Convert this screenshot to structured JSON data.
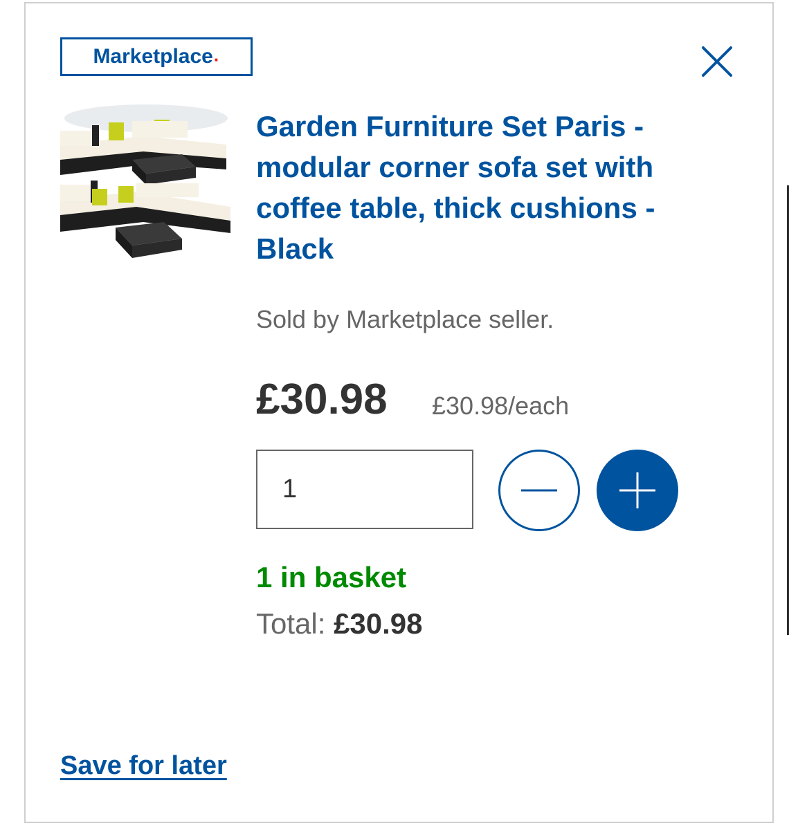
{
  "badge": {
    "label": "Marketplace",
    "dot": "·"
  },
  "close": {
    "icon": "close-icon"
  },
  "product": {
    "image_alt": "Garden furniture set image",
    "title": "Garden Furniture Set Paris - modular corner sofa set with coffee table, thick cushions - Black",
    "seller_text": "Sold by Marketplace seller.",
    "price": "£30.98",
    "unit_price": "£30.98/each"
  },
  "quantity": {
    "value": "1"
  },
  "controls": {
    "minus_icon": "minus-icon",
    "plus_icon": "plus-icon"
  },
  "basket": {
    "status": "1 in basket",
    "total_label": "Total:",
    "total_value": "£30.98"
  },
  "actions": {
    "save_for_later": "Save for later"
  },
  "colors": {
    "brand_blue": "#00539f",
    "success_green": "#008a00",
    "accent_red": "#e81c24",
    "text_dark": "#333333",
    "text_muted": "#666666"
  }
}
